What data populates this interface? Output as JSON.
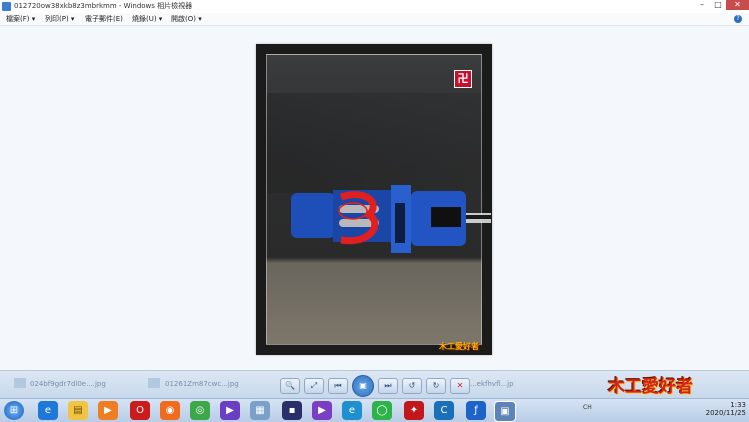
{
  "window": {
    "title": "012720ow38xkb8z3mbrkmm - Windows 相片檢視器",
    "ghost_tabs": [
      "",
      "",
      "",
      ""
    ]
  },
  "menu": {
    "file": "檔案(F) ▾",
    "print": "列印(P) ▾",
    "email": "電子郵件(E)",
    "burn": "燒錄(U) ▾",
    "open": "開啟(O) ▾"
  },
  "photo": {
    "watermark_top": "卍",
    "watermark_bottom": "木工愛好者"
  },
  "filmstrip": {
    "left_label": "024bf9gdr7dl0e....jpg",
    "mid_label": "01261Zm87cwc...jpg",
    "right_label": "...ekfhvfl...jp",
    "controls": [
      "🔍",
      "⤢",
      "⏮",
      "▣",
      "⏭",
      "↺",
      "↻",
      "✕"
    ]
  },
  "brand": "木工愛好者",
  "taskbar": {
    "tray": "CH",
    "time": "1:33",
    "date": "2020/11/25"
  },
  "colors": {
    "accent": "#2c6fc0",
    "close": "#c74c4c",
    "brand": "#d4231a"
  }
}
